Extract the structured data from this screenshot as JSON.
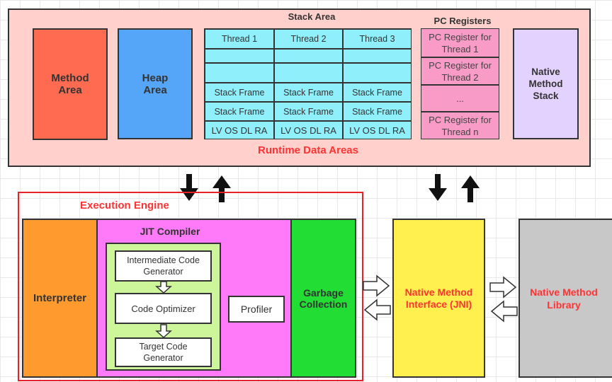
{
  "runtime": {
    "label": "Runtime Data Areas",
    "method_area": "Method Area",
    "heap_area": "Heap Area",
    "stack_area": {
      "title": "Stack Area",
      "threads": [
        "Thread 1",
        "Thread 2",
        "Thread 3"
      ],
      "frame": "Stack Frame",
      "locals": "LV OS DL RA"
    },
    "pc_registers": {
      "title": "PC Registers",
      "items": [
        "PC Register for Thread 1",
        "PC Register for Thread 2",
        "...",
        "PC Register for Thread n"
      ]
    },
    "native_method_stack": "Native Method Stack"
  },
  "execution_engine": {
    "label": "Execution Engine",
    "interpreter": "Interpreter",
    "jit": {
      "title": "JIT Compiler",
      "steps": [
        "Intermediate Code Generator",
        "Code Optimizer",
        "Target Code Generator"
      ],
      "profiler": "Profiler"
    },
    "gc": "Garbage Collection"
  },
  "jni": "Native Method Interface (JNI)",
  "library": "Native Method Library",
  "colors": {
    "runtime_bg": "#ffd0cc",
    "method": "#ff6b50",
    "heap": "#55a5f8",
    "stack": "#8ff0fb",
    "pc": "#f99bc7",
    "native_stack": "#e2d2fd",
    "interpreter": "#ff9a2e",
    "jit": "#ff7af8",
    "jit_inner": "#cdf59a",
    "gc": "#22dd33",
    "jni": "#fff050",
    "library": "#c8c8c8",
    "accent": "#ff3333"
  }
}
